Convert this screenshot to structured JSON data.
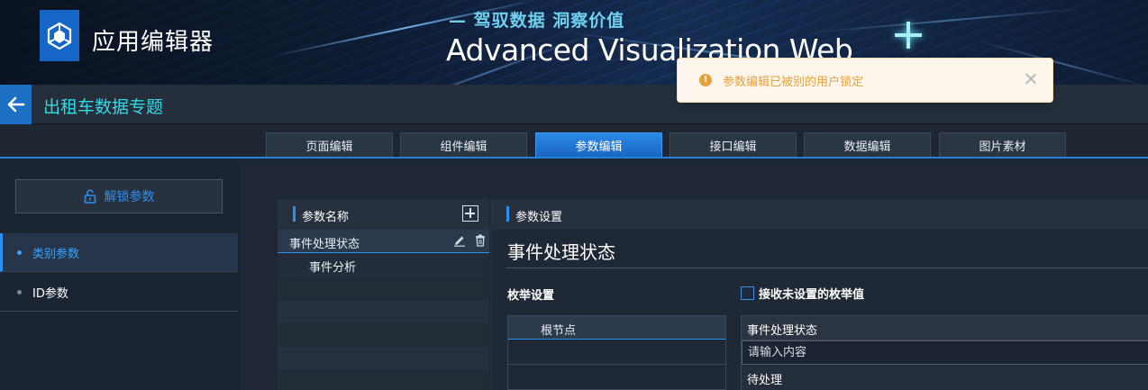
{
  "banner": {
    "app_title": "应用编辑器",
    "slogan": "— 驾驭数据 洞察价值",
    "product_title": "Advanced Visualization Web",
    "logo_icon": "hexagon-logo-icon"
  },
  "project": {
    "title": "出租车数据专题",
    "back_icon": "arrow-left-icon"
  },
  "tabs": [
    {
      "label": "页面编辑",
      "active": false
    },
    {
      "label": "组件编辑",
      "active": false
    },
    {
      "label": "参数编辑",
      "active": true
    },
    {
      "label": "接口编辑",
      "active": false
    },
    {
      "label": "数据编辑",
      "active": false
    },
    {
      "label": "图片素材",
      "active": false
    }
  ],
  "sidebar": {
    "unlock_label": "解锁参数",
    "items": [
      {
        "label": "类别参数",
        "active": true
      },
      {
        "label": "ID参数",
        "active": false
      }
    ]
  },
  "param_list": {
    "header": "参数名称",
    "items": [
      {
        "label": "事件处理状态",
        "selected": true
      },
      {
        "label": "事件分析",
        "selected": false
      }
    ]
  },
  "settings": {
    "header": "参数设置",
    "param_name": "事件处理状态",
    "enum_label": "枚举设置",
    "accept_unset_label": "接收未设置的枚举值",
    "accept_unset_checked": false,
    "tree_root": "根节点",
    "value_header": "事件处理状态",
    "value_placeholder": "请输入内容",
    "values": [
      "待处理"
    ]
  },
  "toast": {
    "message": "参数编辑已被别的用户锁定",
    "type": "warning",
    "color": "#e6a23c"
  },
  "colors": {
    "accent": "#2d8ff0",
    "project_title": "#33d9e6",
    "background": "#1b2532"
  }
}
